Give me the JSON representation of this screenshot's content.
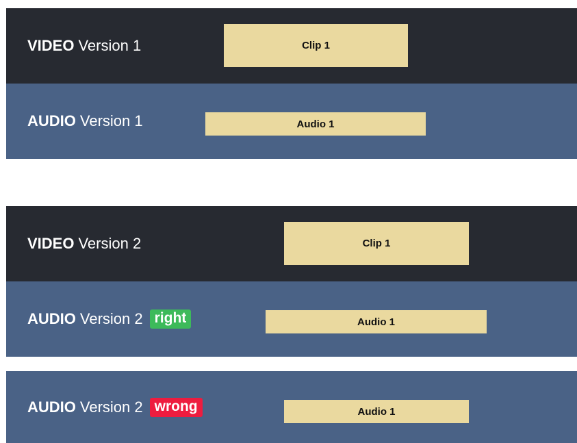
{
  "colors": {
    "video_track": "#272a31",
    "audio_track": "#4a6286",
    "clip": "#ead99f",
    "right_badge": "#3dba5a",
    "wrong_badge": "#ee1c3f"
  },
  "groups": [
    {
      "tracks": [
        {
          "kind": "VIDEO",
          "version": "Version 1",
          "clip": "Clip 1"
        },
        {
          "kind": "AUDIO",
          "version": "Version 1",
          "clip": "Audio 1"
        }
      ]
    },
    {
      "tracks": [
        {
          "kind": "VIDEO",
          "version": "Version 2",
          "clip": "Clip 1"
        },
        {
          "kind": "AUDIO",
          "version": "Version 2",
          "clip": "Audio 1",
          "badge": "right"
        },
        {
          "kind": "AUDIO",
          "version": "Version 2",
          "clip": "Audio 1",
          "badge": "wrong"
        }
      ]
    }
  ]
}
